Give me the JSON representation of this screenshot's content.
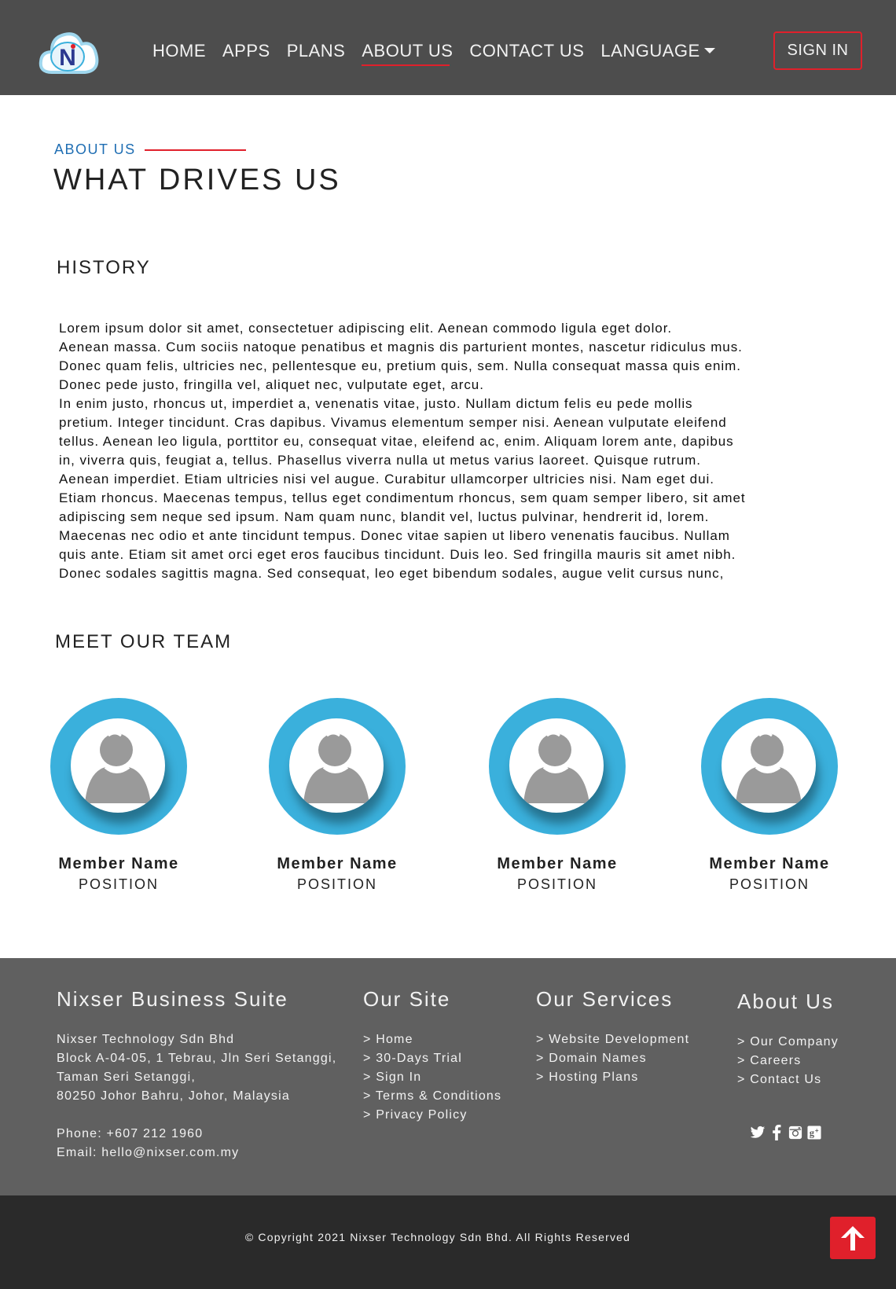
{
  "header": {
    "nav": [
      "HOME",
      "APPS",
      "PLANS",
      "ABOUT US",
      "CONTACT US",
      "LANGUAGE"
    ],
    "active_nav": "ABOUT US",
    "signin_label": "SIGN IN",
    "logo_icon": "cloud-n-logo",
    "accent_color": "#e0202b"
  },
  "hero": {
    "eyebrow": "ABOUT US",
    "title": "WHAT DRIVES US"
  },
  "history": {
    "title": "HISTORY",
    "lines": [
      "Lorem ipsum dolor sit amet, consectetuer adipiscing elit. Aenean commodo ligula eget dolor.",
      "Aenean massa. Cum sociis natoque penatibus et magnis dis parturient montes, nascetur ridiculus mus.",
      "Donec quam felis, ultricies nec, pellentesque eu, pretium quis, sem. Nulla  consequat massa quis enim.",
      "Donec pede justo, fringilla vel, aliquet nec, vulputate eget, arcu.",
      "In enim justo, rhoncus ut, imperdiet a, venenatis vitae, justo. Nullam dictum felis eu pede mollis",
      "pretium. Integer tincidunt. Cras dapibus. Vivamus elementum semper nisi. Aenean vulputate eleifend",
      "tellus. Aenean leo ligula, porttitor eu, consequat vitae, eleifend ac, enim. Aliquam lorem ante, dapibus",
      "in, viverra quis, feugiat a, tellus. Phasellus viverra nulla ut metus varius laoreet. Quisque rutrum.",
      "Aenean imperdiet. Etiam ultricies nisi vel augue. Curabitur ullamcorper ultricies nisi. Nam eget dui.",
      "Etiam rhoncus. Maecenas tempus, tellus eget condimentum rhoncus, sem quam semper libero, sit amet",
      "adipiscing sem neque sed ipsum. Nam quam nunc, blandit vel, luctus pulvinar, hendrerit id, lorem.",
      "Maecenas nec odio et ante tincidunt tempus. Donec vitae sapien ut libero venenatis faucibus. Nullam",
      "quis ante. Etiam sit amet orci eget eros faucibus tincidunt. Duis leo. Sed fringilla mauris sit amet nibh.",
      "Donec sodales sagittis magna. Sed consequat, leo eget bibendum sodales, augue velit cursus nunc,"
    ]
  },
  "team": {
    "title": "MEET OUR TEAM",
    "ring_color": "#3ab0dc",
    "members": [
      {
        "name": "Member Name",
        "position": "POSITION",
        "icon": "person-avatar-icon"
      },
      {
        "name": "Member Name",
        "position": "POSITION",
        "icon": "person-avatar-icon"
      },
      {
        "name": "Member Name",
        "position": "POSITION",
        "icon": "person-avatar-icon"
      },
      {
        "name": "Member Name",
        "position": "POSITION",
        "icon": "person-avatar-icon"
      }
    ]
  },
  "footer": {
    "company": {
      "title": "Nixser Business Suite",
      "name": "Nixser Technology Sdn Bhd",
      "address1": "Block A-04-05, 1 Tebrau, Jln Seri Setanggi,",
      "address2": "Taman Seri Setanggi,",
      "address3": "80250 Johor Bahru, Johor, Malaysia",
      "phone": "Phone: +607 212 1960",
      "email": "Email: hello@nixser.com.my"
    },
    "our_site": {
      "title": "Our Site",
      "links": [
        "> Home",
        "> 30-Days Trial",
        "> Sign In",
        "> Terms & Conditions",
        "> Privacy Policy"
      ]
    },
    "our_services": {
      "title": "Our Services",
      "links": [
        "> Website Development",
        "> Domain Names",
        "> Hosting Plans"
      ]
    },
    "about": {
      "title": "About Us",
      "links": [
        "> Our Company",
        "> Careers",
        "> Contact Us"
      ]
    },
    "social_icons": [
      "twitter-icon",
      "facebook-icon",
      "instagram-icon",
      "google-plus-icon"
    ],
    "copyright": "© Copyright 2021 Nixser Technology Sdn Bhd. All Rights Reserved",
    "back_to_top_icon": "arrow-up-icon"
  }
}
